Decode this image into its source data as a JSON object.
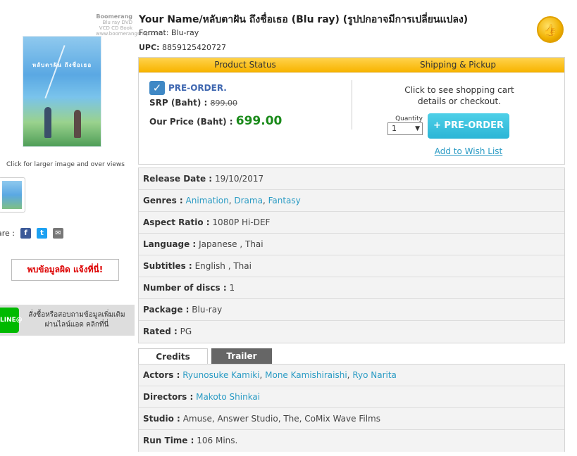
{
  "left": {
    "studio_logo": {
      "name": "Boomerang",
      "tagline": "Blu ray DVD VCD CD Book",
      "url": "www.boomerangshop.com"
    },
    "poster_title": "หลับตาฝัน ถึงชื่อเธอ",
    "click_larger": "Click for larger image and over views",
    "share_label": "are :",
    "share_icons": [
      "facebook-icon",
      "twitter-icon",
      "email-icon"
    ],
    "report_label": "พบข้อมูลผิด แจ้งที่นี่!",
    "line_badge": "LINE@",
    "line_text_1": "สั่งซื้อหรือสอบถามข้อมูลเพิ่มเติม",
    "line_text_2": "ผ่านไลน์แอด คลิกที่นี่"
  },
  "product": {
    "title": "Your Name/หลับตาฝัน ถึงชื่อเธอ (Blu ray) (รูปปกอาจมีการเปลี่ยนแปลง)",
    "format_label": "Format:",
    "format_value": "Blu-ray",
    "upc_label": "UPC:",
    "upc_value": "8859125420727"
  },
  "status": {
    "head_left": "Product Status",
    "head_right": "Shipping & Pickup",
    "preorder_label": "PRE-ORDER.",
    "srp_label": "SRP (Baht) :",
    "srp_value": "899.00",
    "price_label": "Our Price (Baht) :",
    "price_value": "699.00",
    "cart_text_1": "Click to see shopping cart",
    "cart_text_2": "details or checkout.",
    "qty_label": "Quantity",
    "qty_value": "1",
    "preorder_button": "+ PRE-ORDER",
    "wishlist": "Add to Wish List"
  },
  "info": {
    "release_label": "Release Date :",
    "release_value": "19/10/2017",
    "genres_label": "Genres :",
    "genres": [
      "Animation",
      "Drama",
      "Fantasy"
    ],
    "aspect_label": "Aspect Ratio :",
    "aspect_value": "1080P Hi-DEF",
    "language_label": "Language :",
    "language_value": "Japanese , Thai",
    "subtitles_label": "Subtitles :",
    "subtitles_value": "English , Thai",
    "discs_label": "Number of discs :",
    "discs_value": "1",
    "package_label": "Package :",
    "package_value": "Blu-ray",
    "rated_label": "Rated :",
    "rated_value": "PG"
  },
  "tabs": {
    "credits": "Credits",
    "trailer": "Trailer"
  },
  "credits": {
    "actors_label": "Actors :",
    "actors": [
      "Ryunosuke Kamiki",
      "Mone Kamishiraishi",
      "Ryo Narita"
    ],
    "directors_label": "Directors :",
    "director": "Makoto Shinkai",
    "studio_label": "Studio :",
    "studio_value": "Amuse, Answer Studio, The, CoMix Wave Films",
    "runtime_label": "Run Time :",
    "runtime_value": "106 Mins."
  },
  "colors": {
    "accent_link": "#2a9bc4",
    "price_green": "#1a8a1a",
    "header_yellow": "#f8b400",
    "preorder_button": "#2bb5d6",
    "line_green": "#00b900"
  }
}
